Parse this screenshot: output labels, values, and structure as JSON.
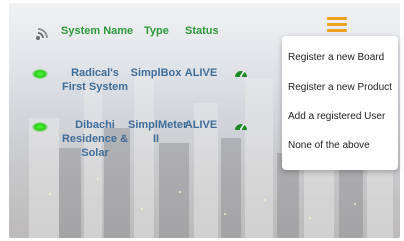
{
  "header": {
    "system_name": "System Name",
    "type": "Type",
    "status": "Status"
  },
  "rows": [
    {
      "name_line1": "Radical's",
      "name_line2": "First System",
      "type_line1": "SimplBox",
      "type_line2": "",
      "status": "ALIVE"
    },
    {
      "name_line1": "Dibachi",
      "name_line2": "Residence &",
      "name_line3": "Solar",
      "type_line1": "SimplMeter",
      "type_line2": "II",
      "status": "ALIVE"
    }
  ],
  "menu": {
    "items": [
      "Register a new Board",
      "Register a new Product",
      "Add a registered User",
      "None of the above"
    ]
  },
  "colors": {
    "header_green": "#2e9a3a",
    "cell_blue": "#3e6d9a",
    "menu_orange": "#f0a020",
    "status_dot": "#2ecc1f"
  },
  "icons": {
    "connection": "wifi-signal-icon",
    "menu": "hamburger-menu-icon",
    "status": "gauge-icon"
  }
}
